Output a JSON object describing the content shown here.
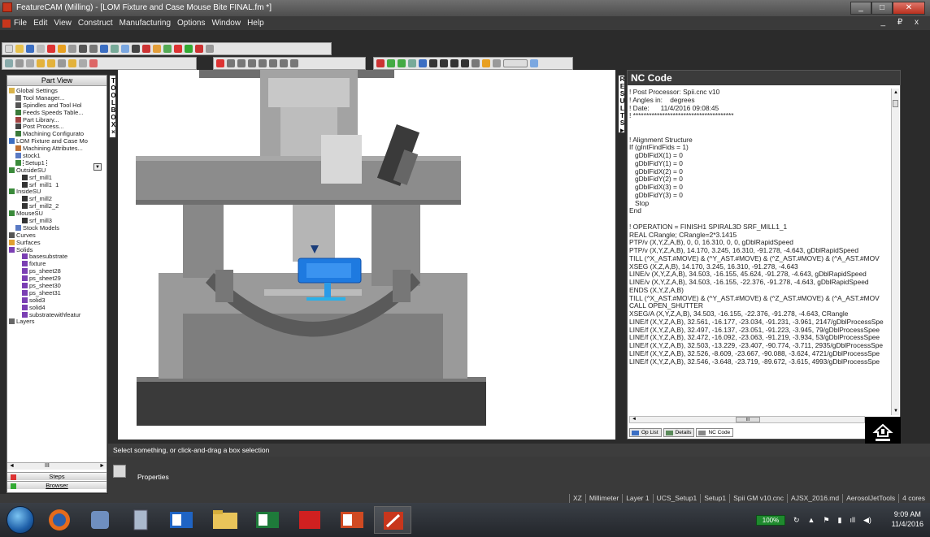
{
  "window": {
    "title": "FeatureCAM (Milling) - [LOM Fixture and Case Mouse Bite FINAL.fm *]",
    "controls": [
      "minimize-icon",
      "maximize-icon",
      "close-icon"
    ]
  },
  "menu": {
    "items": [
      "File",
      "Edit",
      "View",
      "Construct",
      "Manufacturing",
      "Options",
      "Window",
      "Help"
    ],
    "mdi_controls": "_ ₽ x"
  },
  "tree": {
    "header": "Part View",
    "items": [
      {
        "label": "Global Settings",
        "icon": "folder-icon",
        "indent": 0
      },
      {
        "label": "Tool Manager...",
        "icon": "tool-icon",
        "indent": 1
      },
      {
        "label": "Spindles and Tool Hol",
        "icon": "spindle-icon",
        "indent": 1
      },
      {
        "label": "Feeds Speeds Table...",
        "icon": "table-icon",
        "indent": 1
      },
      {
        "label": "Part Library...",
        "icon": "library-icon",
        "indent": 1
      },
      {
        "label": "Post Process...",
        "icon": "post-icon",
        "indent": 1
      },
      {
        "label": "Machining Configurato",
        "icon": "machine-icon",
        "indent": 1
      },
      {
        "label": "LOM Fixture and Case Mo",
        "icon": "document-icon",
        "indent": 0
      },
      {
        "label": "Machining Attributes...",
        "icon": "attributes-icon",
        "indent": 1
      },
      {
        "label": "stock1",
        "icon": "stock-icon",
        "indent": 1
      },
      {
        "label": "Setup1",
        "icon": "setup-icon",
        "indent": 1
      },
      {
        "label": "OutsideSU",
        "icon": "setup-icon",
        "indent": 0
      },
      {
        "label": "srf_mill1",
        "icon": "mill-icon",
        "indent": 2
      },
      {
        "label": "srf_mill1_1",
        "icon": "mill-icon",
        "indent": 2
      },
      {
        "label": "InsideSU",
        "icon": "setup-icon",
        "indent": 0
      },
      {
        "label": "srf_mill2",
        "icon": "mill-icon",
        "indent": 2
      },
      {
        "label": "srf_mill2_2",
        "icon": "mill-icon",
        "indent": 2
      },
      {
        "label": "MouseSU",
        "icon": "setup-icon",
        "indent": 0
      },
      {
        "label": "srf_mill3",
        "icon": "mill-icon",
        "indent": 2
      },
      {
        "label": "Stock Models",
        "icon": "stock-icon",
        "indent": 1
      },
      {
        "label": "Curves",
        "icon": "curve-icon",
        "indent": 0
      },
      {
        "label": "Surfaces",
        "icon": "surface-icon",
        "indent": 0
      },
      {
        "label": "Solids",
        "icon": "solid-icon",
        "indent": 0
      },
      {
        "label": "basesubstrate",
        "icon": "solid-icon",
        "indent": 2
      },
      {
        "label": "fixture",
        "icon": "solid-icon",
        "indent": 2
      },
      {
        "label": "ps_sheet28",
        "icon": "solid-icon",
        "indent": 2
      },
      {
        "label": "ps_sheet29",
        "icon": "solid-icon",
        "indent": 2
      },
      {
        "label": "ps_sheet30",
        "icon": "solid-icon",
        "indent": 2
      },
      {
        "label": "ps_sheet31",
        "icon": "solid-icon",
        "indent": 2
      },
      {
        "label": "solid3",
        "icon": "solid-icon",
        "indent": 2
      },
      {
        "label": "solid4",
        "icon": "solid-icon",
        "indent": 2
      },
      {
        "label": "substratewithfeatur",
        "icon": "solid-icon",
        "indent": 2
      },
      {
        "label": "Layers",
        "icon": "layers-icon",
        "indent": 0
      }
    ],
    "tabs": [
      "Steps",
      "Browser"
    ],
    "scroll_thumb": "III"
  },
  "toolbox": {
    "letters": [
      "T",
      "O",
      "O",
      "L",
      "B",
      "O",
      "X"
    ],
    "close": "×"
  },
  "results": {
    "letters": [
      "R",
      "E",
      "S",
      "U",
      "L",
      "T",
      "S"
    ],
    "arrow": "►"
  },
  "nc": {
    "title": "NC Code",
    "lines": [
      "! Post Processor: Spii.cnc v10",
      "! Angles in:    degrees",
      "! Date:      11/4/2016 09:08:45",
      "! **************************************",
      "",
      "",
      "! Alignment Structure",
      "If (gIntFindFids = 1)",
      "   gDblFidX(1) = 0",
      "   gDblFidY(1) = 0",
      "   gDblFidX(2) = 0",
      "   gDblFidY(2) = 0",
      "   gDblFidX(3) = 0",
      "   gDblFidY(3) = 0",
      "   Stop",
      "End",
      "",
      "! OPERATION = FINISH1 SPIRAL3D SRF_MILL1_1",
      "REAL CRangle; CRangle=2*3.1415",
      "PTP/v (X,Y,Z,A,B), 0, 0, 16.310, 0, 0, gDblRapidSpeed",
      "PTP/v (X,Y,Z,A,B), 14.170, 3.245, 16.310, -91.278, -4.643, gDblRapidSpeed",
      "TILL (^X_AST.#MOVE) & (^Y_AST.#MOVE) & (^Z_AST.#MOVE) & (^A_AST.#MOV",
      "XSEG (X,Z,A,B), 14.170, 3.245, 16.310, -91.278, -4.643",
      "LINE/v (X,Y,Z,A,B), 34.503, -16.155, 45.624, -91.278, -4.643, gDblRapidSpeed",
      "LINE/v (X,Y,Z,A,B), 34.503, -16.155, -22.376, -91.278, -4.643, gDblRapidSpeed",
      "ENDS (X,Y,Z,A,B)",
      "TILL (^X_AST.#MOVE) & (^Y_AST.#MOVE) & (^Z_AST.#MOVE) & (^A_AST.#MOV",
      "CALL OPEN_SHUTTER",
      "XSEG/A (X,Y,Z,A,B), 34.503, -16.155, -22.376, -91.278, -4.643, CRangle",
      "LINE/f (X,Y,Z,A,B), 32.561, -16.177, -23.034, -91.231, -3.961, 2147/gDblProcessSpe",
      "LINE/f (X,Y,Z,A,B), 32.497, -16.137, -23.051, -91.223, -3.945, 79/gDblProcessSpee",
      "LINE/f (X,Y,Z,A,B), 32.472, -16.092, -23.063, -91.219, -3.934, 53/gDblProcessSpee",
      "LINE/f (X,Y,Z,A,B), 32.503, -13.229, -23.407, -90.774, -3.711, 2935/gDblProcessSpe",
      "LINE/f (X,Y,Z,A,B), 32.526, -8.609, -23.667, -90.088, -3.624, 4721/gDblProcessSpe",
      "LINE/f (X,Y,Z,A,B), 32.546, -3.648, -23.719, -89.672, -3.615, 4993/gDblProcessSpe"
    ],
    "hscroll_label": "III",
    "tabs": [
      "Op List",
      "Details",
      "NC Code"
    ]
  },
  "status": {
    "message": "Select something, or click-and-drag a box selection",
    "properties_label": "Properties",
    "bar": [
      "XZ",
      "Millimeter",
      "Layer 1",
      "UCS_Setup1",
      "Setup1",
      "Spii GM v10.cnc",
      "AJSX_2016.md",
      "AerosolJetTools",
      "4 cores"
    ]
  },
  "taskbar": {
    "apps": [
      "start",
      "firefox",
      "app3",
      "calculator",
      "outlook",
      "file-explorer",
      "excel",
      "acrobat",
      "powerpoint",
      "featurecam"
    ],
    "battery": "100%",
    "time": "9:09 AM",
    "date": "11/4/2016"
  },
  "colors": {
    "accent_part": "#1e7ae0",
    "frame_dark": "#2b2b2b",
    "model_gray": "#8c8c8c"
  }
}
